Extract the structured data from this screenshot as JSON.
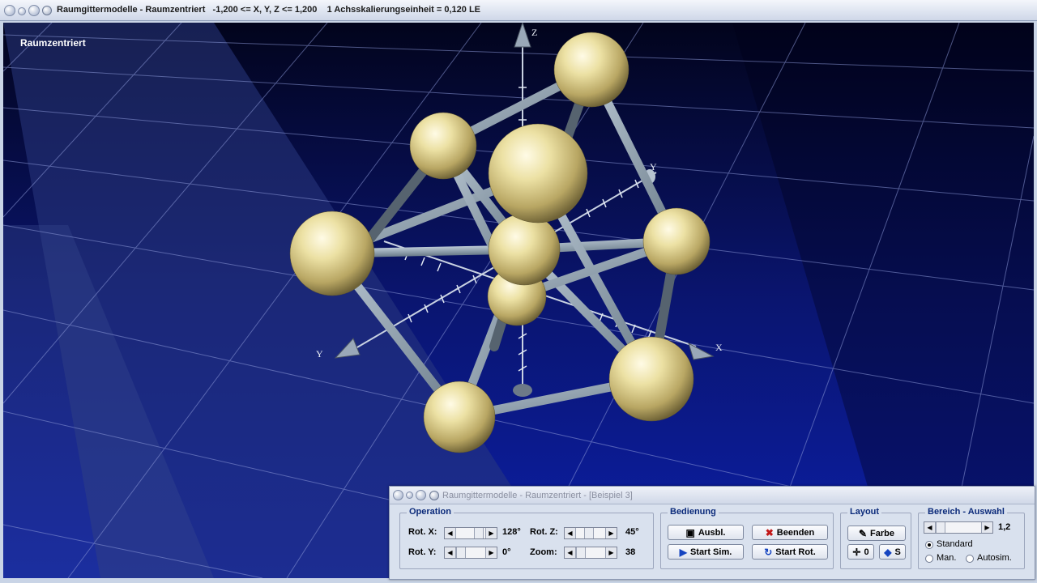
{
  "window": {
    "title": "Raumgittermodelle - Raumzentriert   -1,200 <= X, Y, Z <= 1,200    1 Achsskalierungseinheit = 0,120 LE"
  },
  "scene": {
    "label": "Raumzentriert",
    "axes": {
      "x": "X",
      "y": "Y",
      "z": "Z"
    }
  },
  "panel": {
    "title": "Raumgittermodelle - Raumzentriert - [Beispiel 3]",
    "operation": {
      "label": "Operation",
      "rot_x_label": "Rot. X:",
      "rot_x_value": "128°",
      "rot_y_label": "Rot. Y:",
      "rot_y_value": "0°",
      "rot_z_label": "Rot. Z:",
      "rot_z_value": "45°",
      "zoom_label": "Zoom:",
      "zoom_value": "38"
    },
    "bedienung": {
      "label": "Bedienung",
      "ausbl": "Ausbl.",
      "beenden": "Beenden",
      "start_sim": "Start Sim.",
      "start_rot": "Start Rot."
    },
    "layout": {
      "label": "Layout",
      "farbe": "Farbe",
      "zero": "0",
      "s": "S"
    },
    "bereich": {
      "label": "Bereich - Auswahl",
      "value": "1,2",
      "standard": "Standard",
      "man": "Man.",
      "autosim": "Autosim."
    }
  }
}
